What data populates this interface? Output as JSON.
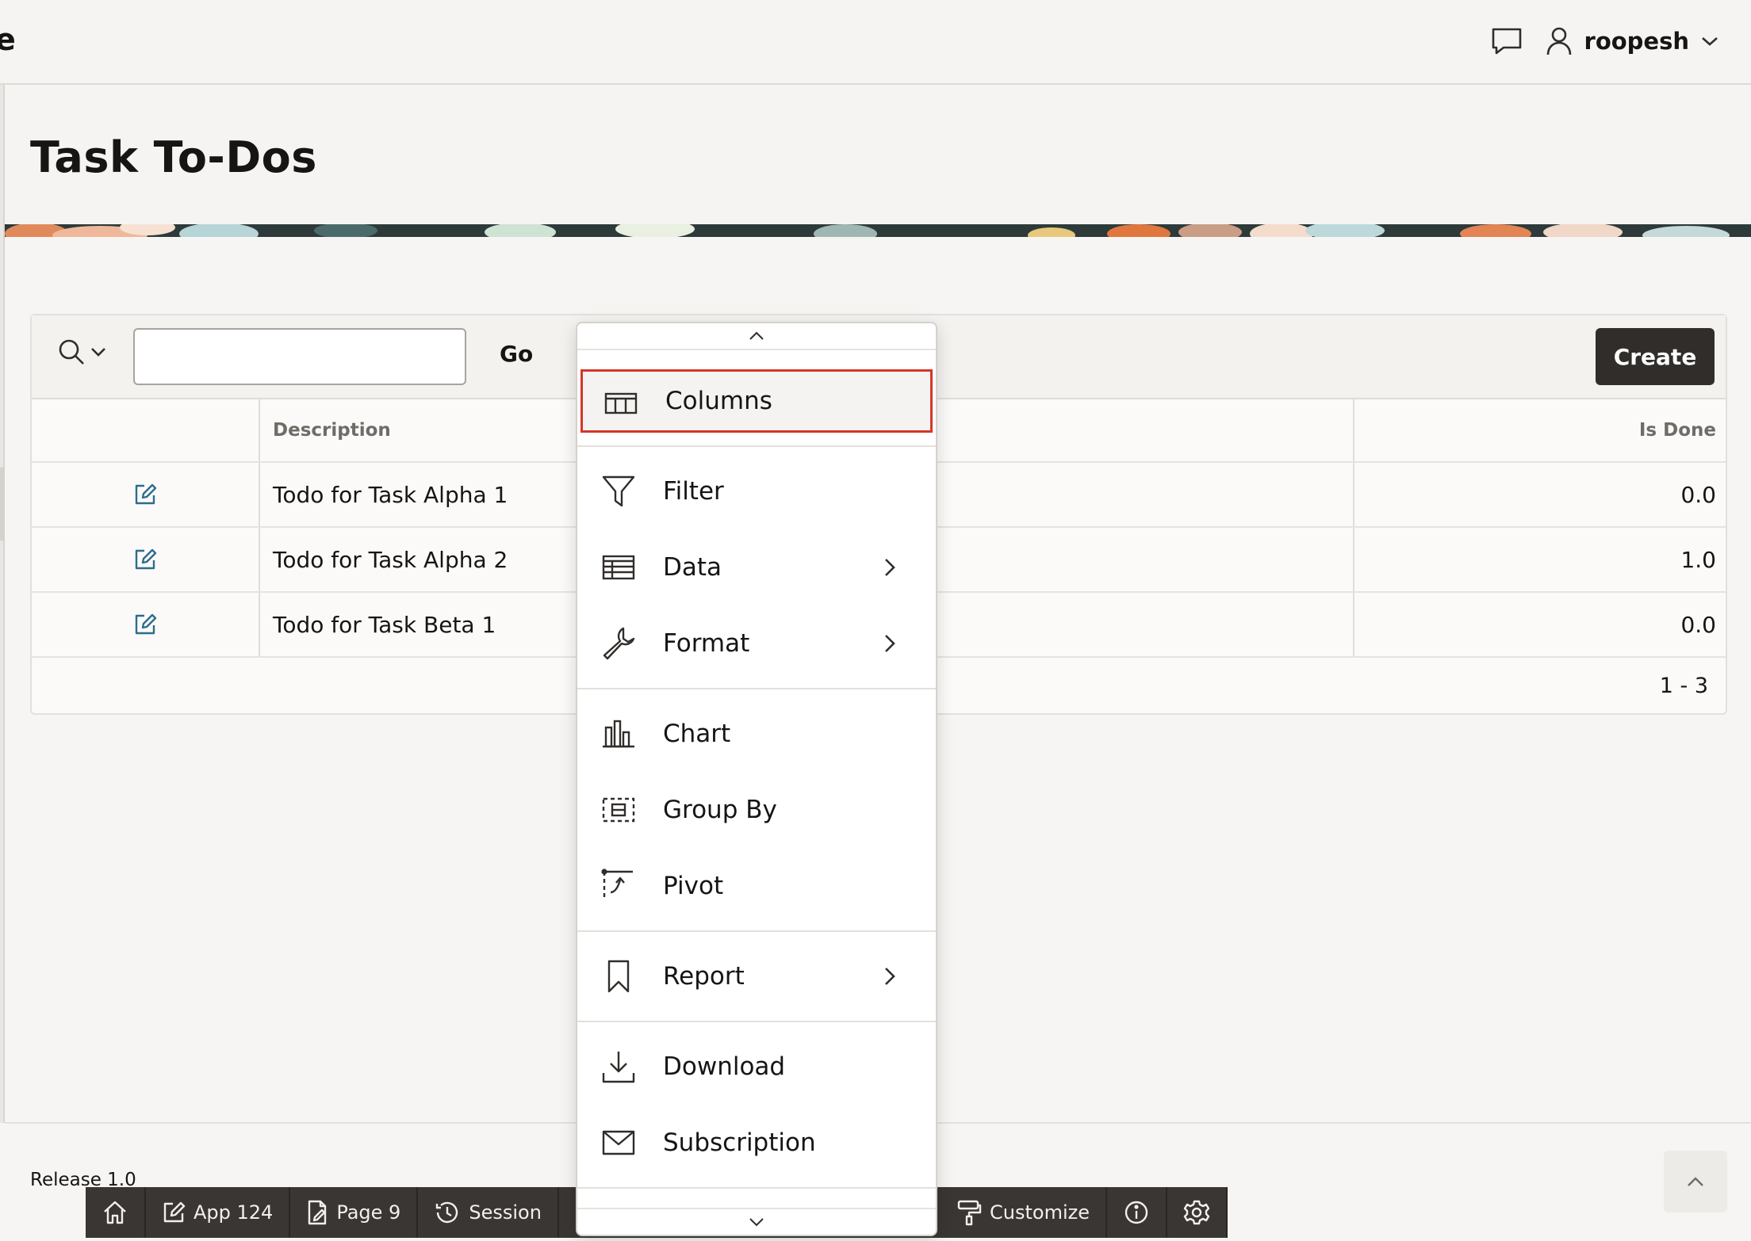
{
  "header": {
    "brand_fragment": "e",
    "user_name": "roopesh"
  },
  "page": {
    "title": "Task To-Dos"
  },
  "toolbar": {
    "search_placeholder": "",
    "go_label": "Go",
    "create_label": "Create"
  },
  "grid": {
    "columns": {
      "edit": "",
      "description": "Description",
      "is_done": "Is Done"
    },
    "rows": [
      {
        "description": "Todo for Task Alpha 1",
        "is_done": "0.0"
      },
      {
        "description": "Todo for Task Alpha 2",
        "is_done": "1.0"
      },
      {
        "description": "Todo for Task Beta 1",
        "is_done": "0.0"
      }
    ],
    "pagination": "1 - 3"
  },
  "actions_menu": {
    "items": [
      {
        "label": "Columns",
        "icon": "columns-icon",
        "submenu": false,
        "focused": true
      },
      {
        "label": "Filter",
        "icon": "filter-icon",
        "submenu": false
      },
      {
        "label": "Data",
        "icon": "data-table-icon",
        "submenu": true
      },
      {
        "label": "Format",
        "icon": "wrench-icon",
        "submenu": true
      },
      {
        "label": "Chart",
        "icon": "bar-chart-icon",
        "submenu": false
      },
      {
        "label": "Group By",
        "icon": "group-by-icon",
        "submenu": false
      },
      {
        "label": "Pivot",
        "icon": "pivot-icon",
        "submenu": false
      },
      {
        "label": "Report",
        "icon": "bookmark-icon",
        "submenu": true
      },
      {
        "label": "Download",
        "icon": "download-icon",
        "submenu": false
      },
      {
        "label": "Subscription",
        "icon": "envelope-icon",
        "submenu": false
      }
    ]
  },
  "footer": {
    "release": "Release 1.0"
  },
  "developer_toolbar": {
    "app": "App 124",
    "page": "Page 9",
    "session": "Session",
    "customize": "Customize"
  },
  "colors": {
    "focus_outline": "#d6362a",
    "create_button": "#312d2a",
    "edit_icon": "#2b6d8f",
    "developer_toolbar": "#3a3633"
  }
}
